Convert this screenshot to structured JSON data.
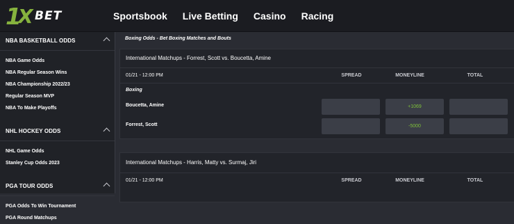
{
  "brand": {
    "logo_one": "1",
    "logo_x": "X",
    "logo_bet": "BET",
    "accent": "#86b23e"
  },
  "nav": [
    "Sportsbook",
    "Live Betting",
    "Casino",
    "Racing"
  ],
  "sidebar": {
    "sections": [
      {
        "title": "NBA BASKETBALL ODDS",
        "items": [
          "NBA Game Odds",
          "NBA Regular Season Wins",
          "NBA Championship 2022/23",
          "Regular Season MVP",
          "NBA To Make Playoffs"
        ]
      },
      {
        "title": "NHL HOCKEY ODDS",
        "items": [
          "NHL Game Odds",
          "Stanley Cup Odds 2023"
        ]
      },
      {
        "title": "PGA TOUR ODDS",
        "items": [
          "PGA Odds To Win Tournament",
          "PGA Round Matchups"
        ]
      }
    ]
  },
  "breadcrumb": "Boxing Odds - Bet Boxing Matches and Bouts",
  "columns": {
    "spread": "SPREAD",
    "moneyline": "MONEYLINE",
    "total": "TOTAL"
  },
  "matchups": [
    {
      "title": "International Matchups - Forrest, Scott vs. Boucetta, Amine",
      "datetime": "01/21 - 12:00 PM",
      "category": "Boxing",
      "rows": [
        {
          "team": "Boucetta, Amine",
          "spread": "",
          "moneyline": "+1069",
          "total": ""
        },
        {
          "team": "Forrest, Scott",
          "spread": "",
          "moneyline": "-5000",
          "total": ""
        }
      ]
    },
    {
      "title": "International Matchups - Harris, Matty vs. Surmaj, Jiri",
      "datetime": "01/21 - 12:00 PM"
    }
  ]
}
